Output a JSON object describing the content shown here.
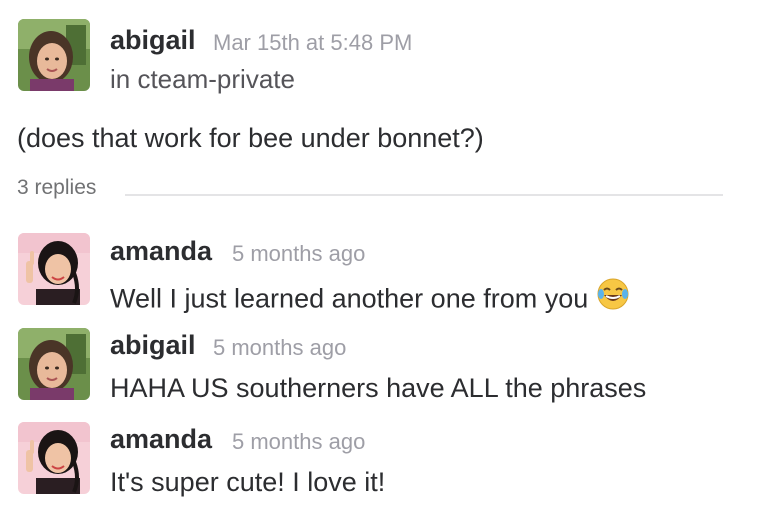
{
  "parent": {
    "author": "abigail",
    "timestamp": "Mar 15th at 5:48 PM",
    "channel": "in cteam-private",
    "text": "(does that work for bee under bonnet?)",
    "avatar_icon": "abigail-avatar"
  },
  "thread": {
    "replies_label": "3 replies",
    "replies": [
      {
        "author": "amanda",
        "time": "5 months ago",
        "text": "Well I just learned another one from you",
        "emoji": "joy-emoji",
        "avatar_icon": "amanda-avatar"
      },
      {
        "author": "abigail",
        "time": "5 months ago",
        "text": "HAHA US southerners have ALL the phrases",
        "avatar_icon": "abigail-avatar"
      },
      {
        "author": "amanda",
        "time": "5 months ago",
        "text": "It's super cute! I love it!",
        "avatar_icon": "amanda-avatar"
      }
    ]
  },
  "colors": {
    "text": "#2c2d30",
    "muted": "#9e9ea6",
    "divider": "#e4e4e6"
  }
}
